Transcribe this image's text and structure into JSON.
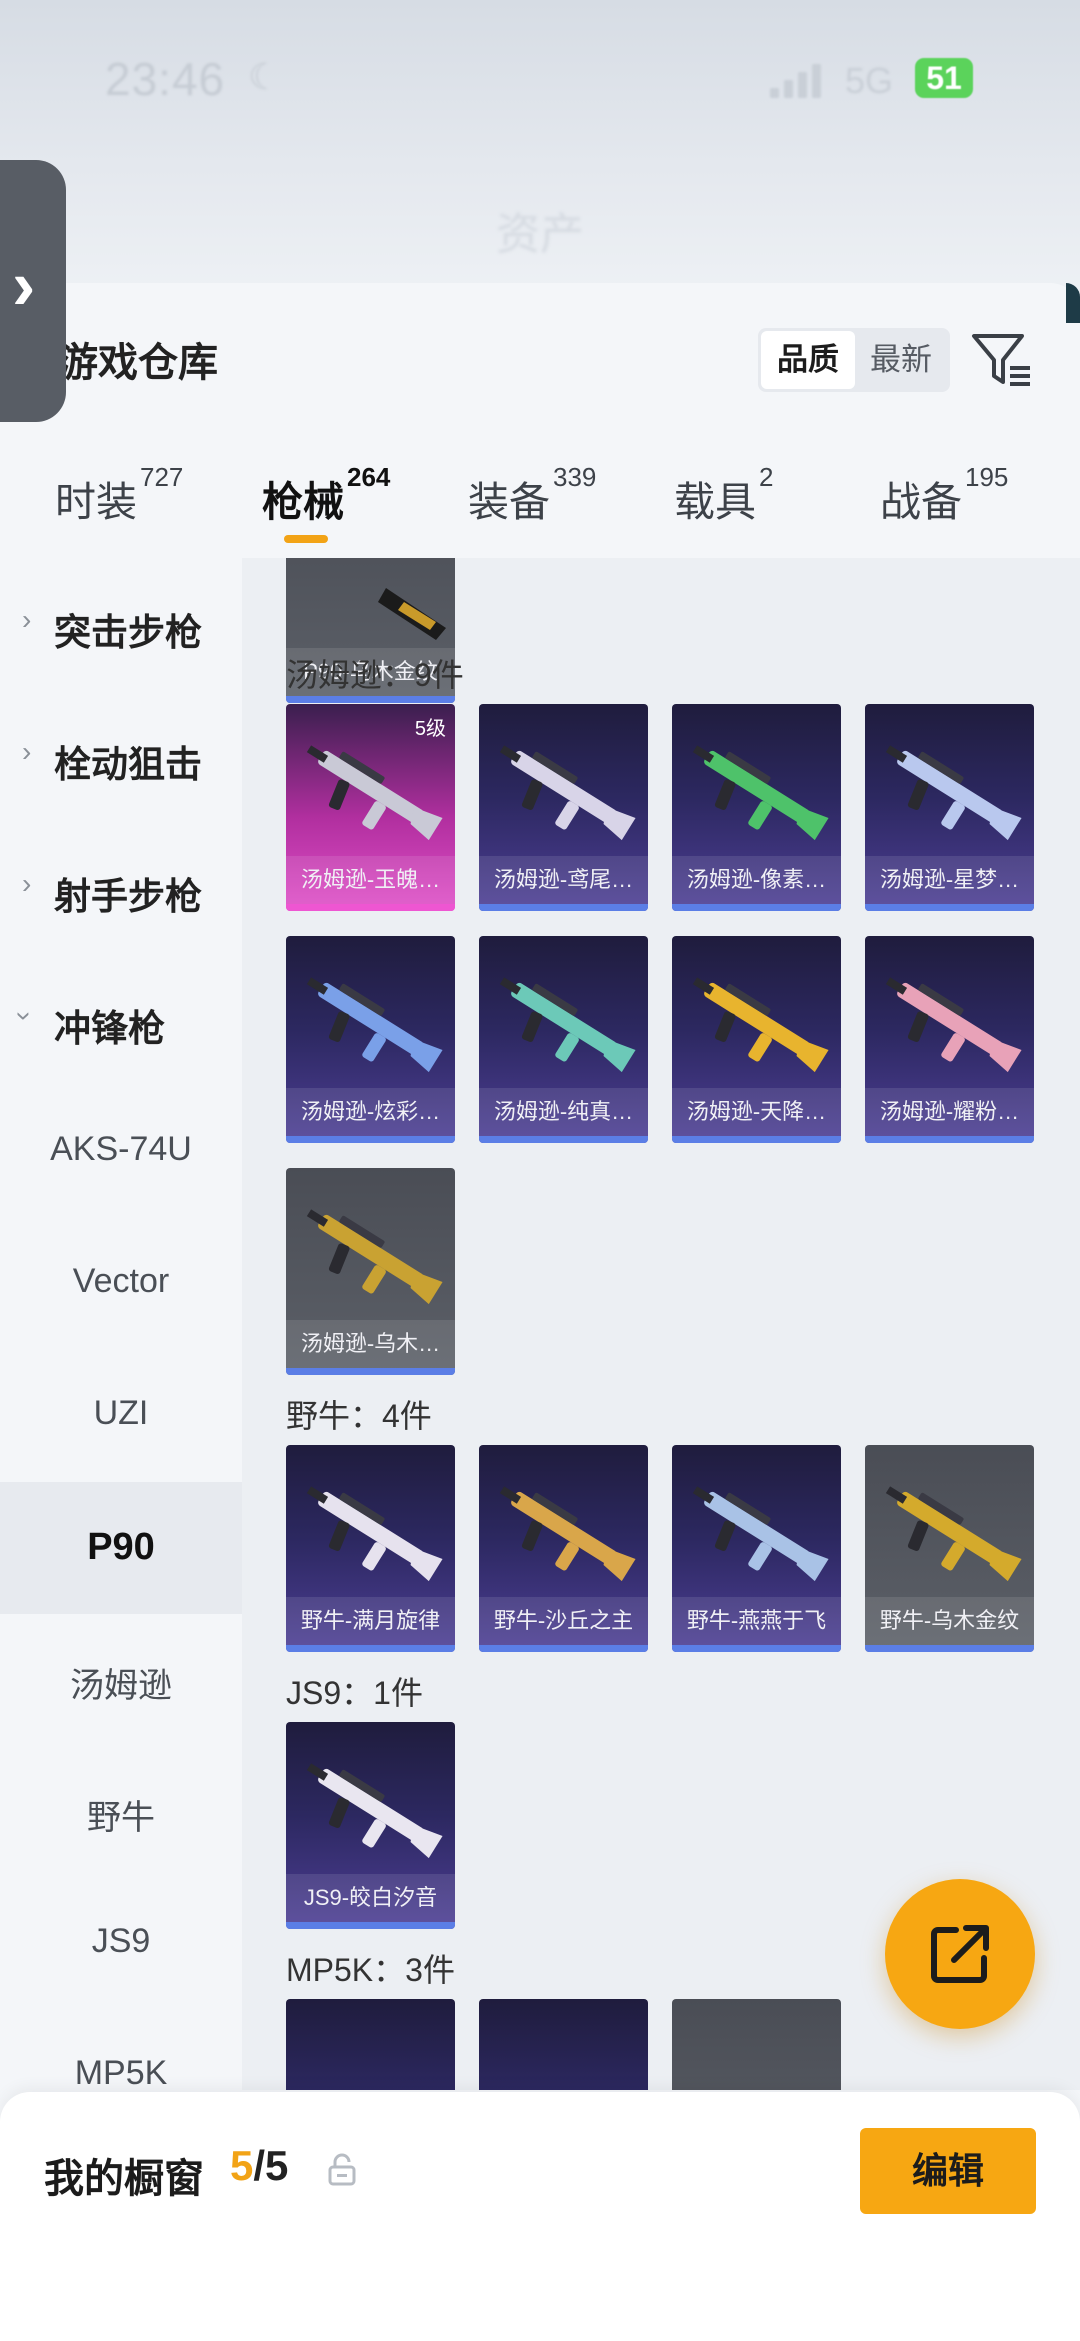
{
  "status_bar": {
    "time": "23:46",
    "network": "5G",
    "battery": "51"
  },
  "header": {
    "title": "资产"
  },
  "panel": {
    "title": "游戏仓库"
  },
  "sort": {
    "active": "品质",
    "inactive": "最新"
  },
  "tabs": [
    {
      "label": "时装",
      "count": "727",
      "active": false
    },
    {
      "label": "枪械",
      "count": "264",
      "active": true
    },
    {
      "label": "装备",
      "count": "339",
      "active": false
    },
    {
      "label": "载具",
      "count": "2",
      "active": false
    },
    {
      "label": "战备",
      "count": "195",
      "active": false
    }
  ],
  "sidebar": {
    "categories": [
      {
        "label": "突击步枪",
        "expanded": false
      },
      {
        "label": "栓动狙击",
        "expanded": false
      },
      {
        "label": "射手步枪",
        "expanded": false
      },
      {
        "label": "冲锋枪",
        "expanded": true
      }
    ],
    "subitems": [
      {
        "label": "AKS-74U",
        "selected": false
      },
      {
        "label": "Vector",
        "selected": false
      },
      {
        "label": "UZI",
        "selected": false
      },
      {
        "label": "P90",
        "selected": true
      },
      {
        "label": "汤姆逊",
        "selected": false
      },
      {
        "label": "野牛",
        "selected": false
      },
      {
        "label": "JS9",
        "selected": false
      },
      {
        "label": "MP5K",
        "selected": false
      }
    ]
  },
  "content": {
    "p90_tail": {
      "name": "P90-乌木金纹"
    },
    "sections": [
      {
        "heading": "汤姆逊：9件",
        "items": [
          {
            "name": "汤姆逊-玉魄…",
            "level": "5级",
            "style": "pink",
            "accent": "#c9c9d6"
          },
          {
            "name": "汤姆逊-鸢尾…",
            "style": "gold",
            "accent": "#d8d4e8"
          },
          {
            "name": "汤姆逊-像素…",
            "style": "gold",
            "accent": "#4ec26a"
          },
          {
            "name": "汤姆逊-星梦…",
            "style": "gold",
            "accent": "#b9c8ee"
          },
          {
            "name": "汤姆逊-炫彩…",
            "style": "gold",
            "accent": "#7aa0e8"
          },
          {
            "name": "汤姆逊-纯真…",
            "style": "gold",
            "accent": "#6cc9b8"
          },
          {
            "name": "汤姆逊-天降…",
            "style": "gold",
            "accent": "#e8b42e"
          },
          {
            "name": "汤姆逊-耀粉…",
            "style": "gold",
            "accent": "#e8a2b8"
          },
          {
            "name": "汤姆逊-乌木…",
            "style": "grey",
            "accent": "#c9a232"
          }
        ]
      },
      {
        "heading": "野牛：4件",
        "items": [
          {
            "name": "野牛-满月旋律",
            "style": "gold",
            "accent": "#e6e2ee"
          },
          {
            "name": "野牛-沙丘之主",
            "style": "gold",
            "accent": "#d9a64a"
          },
          {
            "name": "野牛-燕燕于飞",
            "style": "gold",
            "accent": "#a9c2e6"
          },
          {
            "name": "野牛-乌木金纹",
            "style": "grey",
            "accent": "#d4aa2c"
          }
        ]
      },
      {
        "heading": "JS9：1件",
        "items": [
          {
            "name": "JS9-皎白汐音",
            "style": "gold",
            "accent": "#e9e6f0"
          }
        ]
      },
      {
        "heading": "MP5K：3件",
        "items": []
      }
    ]
  },
  "showcase": {
    "title": "我的橱窗",
    "current": "5",
    "total": "/5",
    "edit_label": "编辑"
  },
  "colors": {
    "accent": "#f7a712",
    "epic_bar": "#5b7ee6",
    "legend_bar": "#ee56d2"
  }
}
